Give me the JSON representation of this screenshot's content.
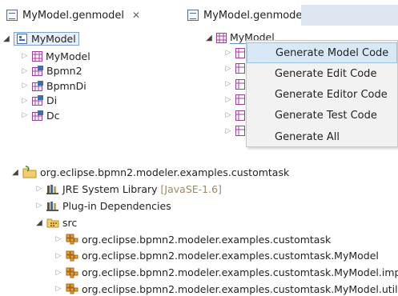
{
  "left_editor": {
    "tab_title": "MyModel.genmodel",
    "close_glyph": "✕",
    "tree": {
      "root_label": "MyModel",
      "children": [
        "MyModel",
        "Bpmn2",
        "BpmnDi",
        "Di",
        "Dc"
      ]
    }
  },
  "right_editor": {
    "tab_title": "MyModel.genmodel",
    "close_glyph": "✕",
    "root_label": "MyModel"
  },
  "context_menu": {
    "items": [
      "Generate Model Code",
      "Generate Edit Code",
      "Generate Editor Code",
      "Generate Test Code",
      "Generate All"
    ],
    "selected_index": 0
  },
  "project_explorer": {
    "project_name": "org.eclipse.bpmn2.modeler.examples.customtask",
    "jre_label": "JRE System Library",
    "jre_version": "[JavaSE-1.6]",
    "plugin_deps": "Plug-in Dependencies",
    "src_folder": "src",
    "packages": [
      "org.eclipse.bpmn2.modeler.examples.customtask",
      "org.eclipse.bpmn2.modeler.examples.customtask.MyModel",
      "org.eclipse.bpmn2.modeler.examples.customtask.MyModel.imp",
      "org.eclipse.bpmn2.modeler.examples.customtask.MyModel.util"
    ]
  },
  "colors": {
    "selection_fill": "#d9e8f7",
    "selection_border": "#9cc3ea",
    "jre_version_color": "#9a8a6a",
    "package_orange": "#e8a33c"
  }
}
